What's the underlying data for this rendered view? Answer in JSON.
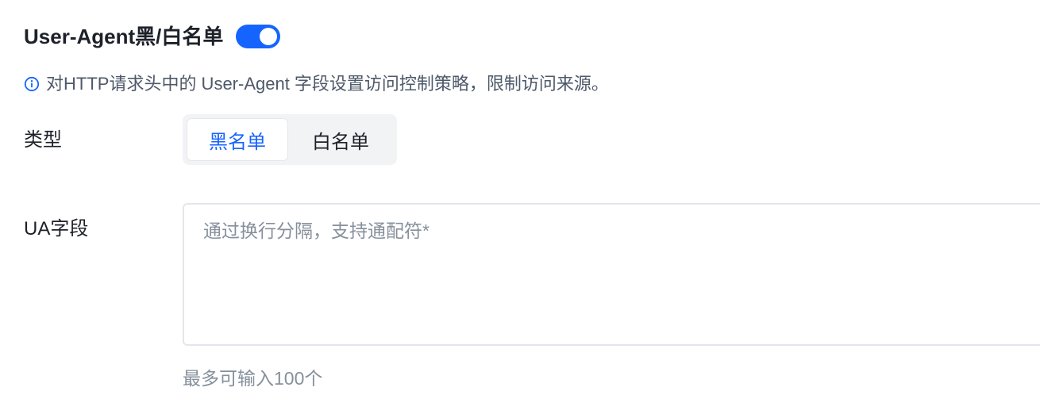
{
  "header": {
    "title": "User-Agent黑/白名单",
    "toggle_on": true
  },
  "info": {
    "icon": "info-circle-icon",
    "text": "对HTTP请求头中的 User-Agent 字段设置访问控制策略，限制访问来源。"
  },
  "type_field": {
    "label": "类型",
    "options": [
      "黑名单",
      "白名单"
    ],
    "selected": "黑名单"
  },
  "ua_field": {
    "label": "UA字段",
    "placeholder": "通过换行分隔，支持通配符*",
    "value": "",
    "hint": "最多可输入100个"
  },
  "colors": {
    "accent": "#1664ff",
    "text_primary": "#1d2129",
    "text_secondary": "#4e5969",
    "placeholder": "#86909c",
    "segment_bg": "#f2f3f5"
  }
}
